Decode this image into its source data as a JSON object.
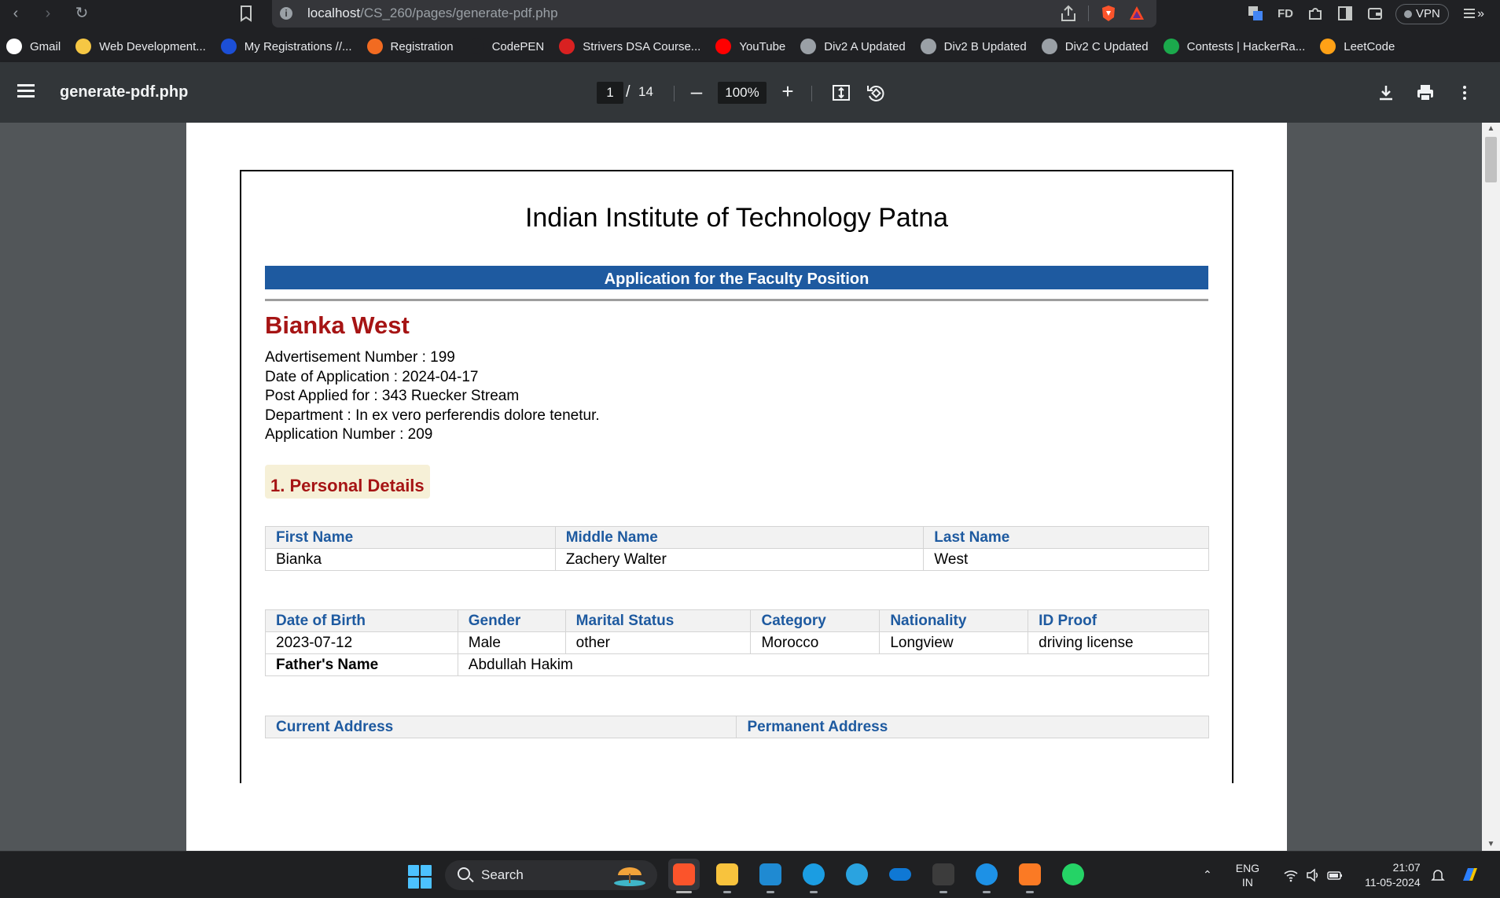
{
  "browser": {
    "url_host": "localhost",
    "url_path": "/CS_260/pages/generate-pdf.php",
    "vpn_label": "VPN",
    "ext_fd_label": "FD",
    "bookmarks": [
      {
        "label": "Gmail",
        "icon": "google-icon",
        "color": "#ffffff"
      },
      {
        "label": "Web Development...",
        "icon": "web-dev-icon",
        "color": "#f6c744"
      },
      {
        "label": "My Registrations //...",
        "icon": "unstop-icon",
        "color": "#1c4fd6"
      },
      {
        "label": "Registration",
        "icon": "registration-icon",
        "color": "#f26b21"
      },
      {
        "label": "CodePEN",
        "icon": "codepen-icon",
        "color": "#202124"
      },
      {
        "label": "Strivers DSA Course...",
        "icon": "tuf-icon",
        "color": "#d92121"
      },
      {
        "label": "YouTube",
        "icon": "youtube-icon",
        "color": "#ff0000"
      },
      {
        "label": "Div2 A Updated",
        "icon": "globe-icon",
        "color": "#9aa0a6"
      },
      {
        "label": "Div2 B Updated",
        "icon": "globe-icon",
        "color": "#9aa0a6"
      },
      {
        "label": "Div2 C Updated",
        "icon": "globe-icon",
        "color": "#9aa0a6"
      },
      {
        "label": "Contests | HackerRa...",
        "icon": "hackerrank-icon",
        "color": "#1ba94c"
      },
      {
        "label": "LeetCode",
        "icon": "leetcode-icon",
        "color": "#ffa116"
      }
    ],
    "more_label": "»"
  },
  "pdf_viewer": {
    "file_name": "generate-pdf.php",
    "current_page": "1",
    "page_separator": "/",
    "total_pages": "14",
    "zoom": "100%"
  },
  "document": {
    "institute": "Indian Institute of Technology Patna",
    "banner": "Application for the Faculty Position",
    "applicant_name": "Bianka West",
    "meta": {
      "advertisement": "Advertisement Number : 199",
      "date": "Date of Application : 2024-04-17",
      "post": "Post Applied for : 343 Ruecker Stream",
      "department": "Department : In ex vero perferendis dolore tenetur.",
      "application": "Application Number : 209"
    },
    "section_title": "1. Personal Details",
    "name_table": {
      "headers": [
        "First Name",
        "Middle Name",
        "Last Name"
      ],
      "values": [
        "Bianka",
        "Zachery Walter",
        "West"
      ]
    },
    "details_table": {
      "headers": [
        "Date of Birth",
        "Gender",
        "Marital Status",
        "Category",
        "Nationality",
        "ID Proof"
      ],
      "values": [
        "2023-07-12",
        "Male",
        "other",
        "Morocco",
        "Longview",
        "driving license"
      ],
      "father_label": "Father's Name",
      "father_value": "Abdullah Hakim"
    },
    "address_table": {
      "headers": [
        "Current Address",
        "Permanent Address"
      ]
    }
  },
  "taskbar": {
    "search_placeholder": "Search",
    "lang_line1": "ENG",
    "lang_line2": "IN",
    "time": "21:07",
    "date": "11-05-2024",
    "apps": [
      "brave-browser-icon",
      "file-explorer-icon",
      "vscode-icon",
      "edge-icon",
      "telegram-icon",
      "onedrive-icon",
      "terminal-icon",
      "docker-icon",
      "xampp-icon",
      "whatsapp-icon"
    ]
  }
}
